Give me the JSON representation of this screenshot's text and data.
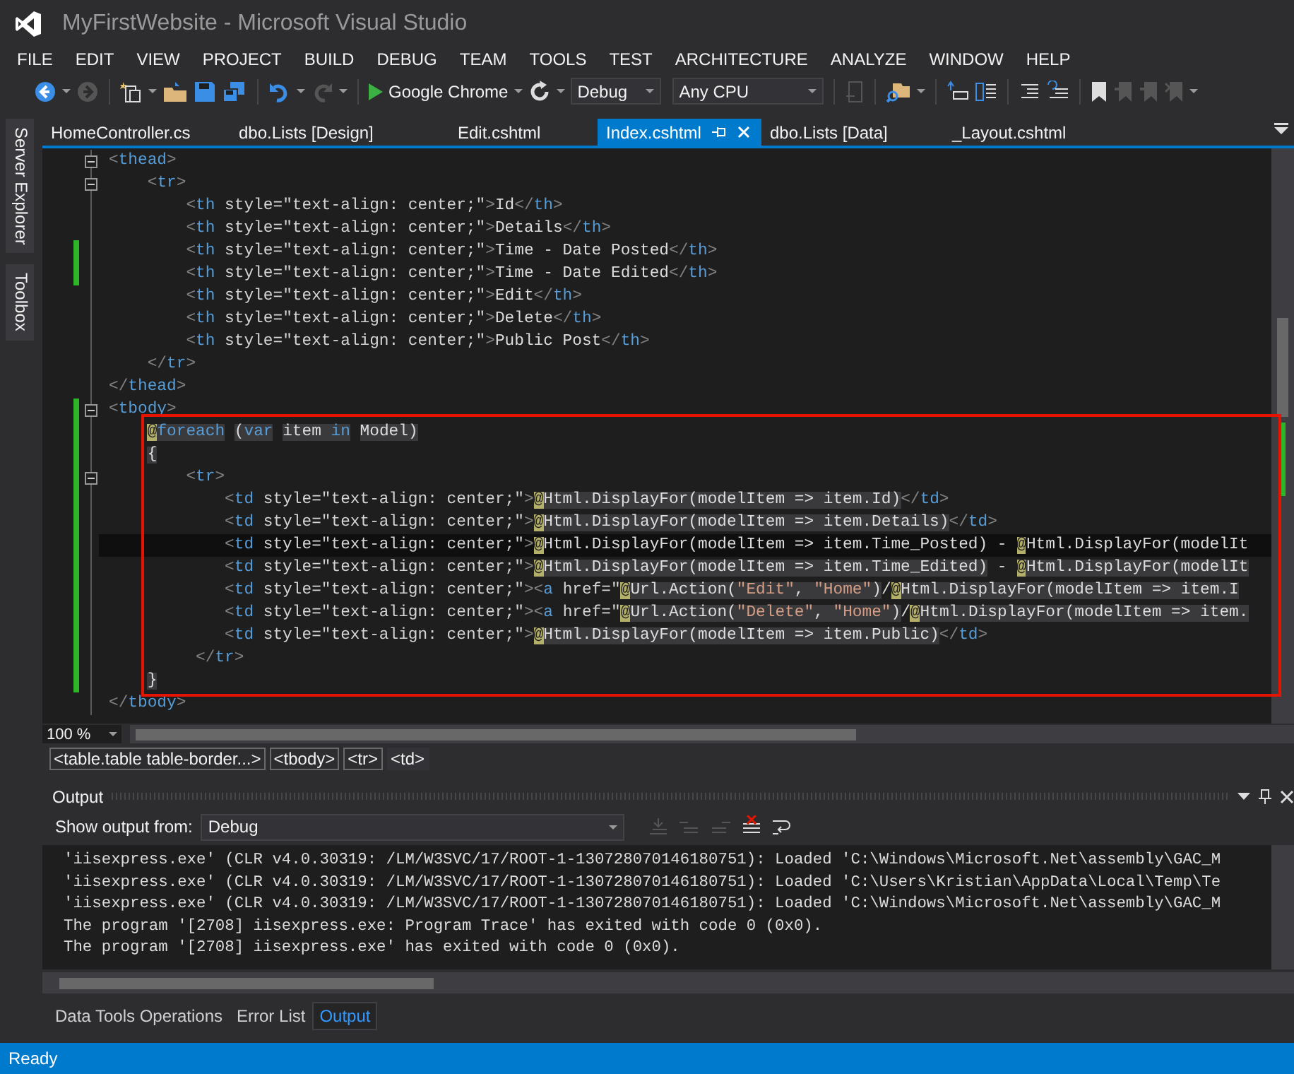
{
  "window": {
    "title": "MyFirstWebsite - Microsoft Visual Studio"
  },
  "menu": [
    "FILE",
    "EDIT",
    "VIEW",
    "PROJECT",
    "BUILD",
    "DEBUG",
    "TEAM",
    "TOOLS",
    "TEST",
    "ARCHITECTURE",
    "ANALYZE",
    "WINDOW",
    "HELP"
  ],
  "toolbar": {
    "run_target": "Google Chrome",
    "configuration": "Debug",
    "platform": "Any CPU"
  },
  "side_tabs": [
    "Server Explorer",
    "Toolbox"
  ],
  "tabs": [
    {
      "label": "HomeController.cs",
      "selected": false
    },
    {
      "label": "dbo.Lists [Design]",
      "selected": false
    },
    {
      "label": "Edit.cshtml",
      "selected": false
    },
    {
      "label": "Index.cshtml",
      "selected": true
    },
    {
      "label": "dbo.Lists [Data]",
      "selected": false
    },
    {
      "label": "_Layout.cshtml",
      "selected": false
    }
  ],
  "editor": {
    "lines": [
      {
        "changed": false,
        "current": false,
        "fold_marker": true,
        "tokens": [
          {
            "text": "<",
            "kind": "p"
          },
          {
            "text": "thead",
            "kind": "tag"
          },
          {
            "text": ">",
            "kind": "p"
          }
        ]
      },
      {
        "changed": false,
        "current": false,
        "fold_marker": true,
        "tokens": [
          {
            "text": "    <",
            "kind": "p"
          },
          {
            "text": "tr",
            "kind": "tag"
          },
          {
            "text": ">",
            "kind": "p"
          }
        ]
      },
      {
        "changed": false,
        "current": false,
        "fold_marker": false,
        "tokens": [
          {
            "text": "        <",
            "kind": "p"
          },
          {
            "text": "th",
            "kind": "tag"
          },
          {
            "text": " style=",
            "kind": "attr"
          },
          {
            "text": "\"text-align: center;\"",
            "kind": "str"
          },
          {
            "text": ">",
            "kind": "p"
          },
          {
            "text": "Id",
            "kind": "txt"
          },
          {
            "text": "</",
            "kind": "p"
          },
          {
            "text": "th",
            "kind": "tag"
          },
          {
            "text": ">",
            "kind": "p"
          }
        ]
      },
      {
        "changed": false,
        "current": false,
        "fold_marker": false,
        "tokens": [
          {
            "text": "        <",
            "kind": "p"
          },
          {
            "text": "th",
            "kind": "tag"
          },
          {
            "text": " style=",
            "kind": "attr"
          },
          {
            "text": "\"text-align: center;\"",
            "kind": "str"
          },
          {
            "text": ">",
            "kind": "p"
          },
          {
            "text": "Details",
            "kind": "txt"
          },
          {
            "text": "</",
            "kind": "p"
          },
          {
            "text": "th",
            "kind": "tag"
          },
          {
            "text": ">",
            "kind": "p"
          }
        ]
      },
      {
        "changed": true,
        "current": false,
        "fold_marker": false,
        "tokens": [
          {
            "text": "        <",
            "kind": "p"
          },
          {
            "text": "th",
            "kind": "tag"
          },
          {
            "text": " style=",
            "kind": "attr"
          },
          {
            "text": "\"text-align: center;\"",
            "kind": "str"
          },
          {
            "text": ">",
            "kind": "p"
          },
          {
            "text": "Time - Date Posted",
            "kind": "txt"
          },
          {
            "text": "</",
            "kind": "p"
          },
          {
            "text": "th",
            "kind": "tag"
          },
          {
            "text": ">",
            "kind": "p"
          }
        ]
      },
      {
        "changed": true,
        "current": false,
        "fold_marker": false,
        "tokens": [
          {
            "text": "        <",
            "kind": "p"
          },
          {
            "text": "th",
            "kind": "tag"
          },
          {
            "text": " style=",
            "kind": "attr"
          },
          {
            "text": "\"text-align: center;\"",
            "kind": "str"
          },
          {
            "text": ">",
            "kind": "p"
          },
          {
            "text": "Time - Date Edited",
            "kind": "txt"
          },
          {
            "text": "</",
            "kind": "p"
          },
          {
            "text": "th",
            "kind": "tag"
          },
          {
            "text": ">",
            "kind": "p"
          }
        ]
      },
      {
        "changed": false,
        "current": false,
        "fold_marker": false,
        "tokens": [
          {
            "text": "        <",
            "kind": "p"
          },
          {
            "text": "th",
            "kind": "tag"
          },
          {
            "text": " style=",
            "kind": "attr"
          },
          {
            "text": "\"text-align: center;\"",
            "kind": "str"
          },
          {
            "text": ">",
            "kind": "p"
          },
          {
            "text": "Edit",
            "kind": "txt"
          },
          {
            "text": "</",
            "kind": "p"
          },
          {
            "text": "th",
            "kind": "tag"
          },
          {
            "text": ">",
            "kind": "p"
          }
        ]
      },
      {
        "changed": false,
        "current": false,
        "fold_marker": false,
        "tokens": [
          {
            "text": "        <",
            "kind": "p"
          },
          {
            "text": "th",
            "kind": "tag"
          },
          {
            "text": " style=",
            "kind": "attr"
          },
          {
            "text": "\"text-align: center;\"",
            "kind": "str"
          },
          {
            "text": ">",
            "kind": "p"
          },
          {
            "text": "Delete",
            "kind": "txt"
          },
          {
            "text": "</",
            "kind": "p"
          },
          {
            "text": "th",
            "kind": "tag"
          },
          {
            "text": ">",
            "kind": "p"
          }
        ]
      },
      {
        "changed": false,
        "current": false,
        "fold_marker": false,
        "tokens": [
          {
            "text": "        <",
            "kind": "p"
          },
          {
            "text": "th",
            "kind": "tag"
          },
          {
            "text": " style=",
            "kind": "attr"
          },
          {
            "text": "\"text-align: center;\"",
            "kind": "str"
          },
          {
            "text": ">",
            "kind": "p"
          },
          {
            "text": "Public Post",
            "kind": "txt"
          },
          {
            "text": "</",
            "kind": "p"
          },
          {
            "text": "th",
            "kind": "tag"
          },
          {
            "text": ">",
            "kind": "p"
          }
        ]
      },
      {
        "changed": false,
        "current": false,
        "fold_marker": false,
        "tokens": [
          {
            "text": "    </",
            "kind": "p"
          },
          {
            "text": "tr",
            "kind": "tag"
          },
          {
            "text": ">",
            "kind": "p"
          }
        ]
      },
      {
        "changed": false,
        "current": false,
        "fold_marker": false,
        "tokens": [
          {
            "text": "</",
            "kind": "p"
          },
          {
            "text": "thead",
            "kind": "tag"
          },
          {
            "text": ">",
            "kind": "p"
          }
        ]
      },
      {
        "changed": true,
        "current": false,
        "fold_marker": true,
        "tokens": [
          {
            "text": "<",
            "kind": "p"
          },
          {
            "text": "tbody",
            "kind": "tag"
          },
          {
            "text": ">",
            "kind": "p"
          }
        ]
      },
      {
        "changed": true,
        "current": false,
        "fold_marker": false,
        "tokens": [
          {
            "text": "    @",
            "kind": "at"
          },
          {
            "text": "foreach",
            "kind": "rkw"
          },
          {
            "text": " (",
            "kind": "razor"
          },
          {
            "text": "var",
            "kind": "rkw"
          },
          {
            "text": " item ",
            "kind": "razor"
          },
          {
            "text": "in",
            "kind": "rkw"
          },
          {
            "text": " Model)",
            "kind": "razor"
          }
        ]
      },
      {
        "changed": true,
        "current": false,
        "fold_marker": false,
        "tokens": [
          {
            "text": "    {",
            "kind": "razor"
          }
        ]
      },
      {
        "changed": true,
        "current": false,
        "fold_marker": true,
        "tokens": [
          {
            "text": "        <",
            "kind": "p"
          },
          {
            "text": "tr",
            "kind": "tag"
          },
          {
            "text": ">",
            "kind": "p"
          }
        ]
      },
      {
        "changed": true,
        "current": false,
        "fold_marker": false,
        "tokens": [
          {
            "text": "            <",
            "kind": "p"
          },
          {
            "text": "td",
            "kind": "tag"
          },
          {
            "text": " style=",
            "kind": "attr"
          },
          {
            "text": "\"text-align: center;\"",
            "kind": "str"
          },
          {
            "text": ">",
            "kind": "p"
          },
          {
            "text": "@",
            "kind": "at"
          },
          {
            "text": "Html.DisplayFor(modelItem => item.Id)",
            "kind": "razor"
          },
          {
            "text": "</",
            "kind": "p"
          },
          {
            "text": "td",
            "kind": "tag"
          },
          {
            "text": ">",
            "kind": "p"
          }
        ]
      },
      {
        "changed": true,
        "current": false,
        "fold_marker": false,
        "tokens": [
          {
            "text": "            <",
            "kind": "p"
          },
          {
            "text": "td",
            "kind": "tag"
          },
          {
            "text": " style=",
            "kind": "attr"
          },
          {
            "text": "\"text-align: center;\"",
            "kind": "str"
          },
          {
            "text": ">",
            "kind": "p"
          },
          {
            "text": "@",
            "kind": "at"
          },
          {
            "text": "Html.DisplayFor(modelItem => item.Details)",
            "kind": "razor"
          },
          {
            "text": "</",
            "kind": "p"
          },
          {
            "text": "td",
            "kind": "tag"
          },
          {
            "text": ">",
            "kind": "p"
          }
        ]
      },
      {
        "changed": true,
        "current": true,
        "fold_marker": false,
        "tokens": [
          {
            "text": "            <",
            "kind": "p"
          },
          {
            "text": "td",
            "kind": "tag"
          },
          {
            "text": " style=",
            "kind": "attr"
          },
          {
            "text": "\"text-align: center;\"",
            "kind": "str"
          },
          {
            "text": ">",
            "kind": "p"
          },
          {
            "text": "@",
            "kind": "at"
          },
          {
            "text": "Html.DisplayFor(modelItem => item.Time_Posted) - ",
            "kind": "txt"
          },
          {
            "text": "@",
            "kind": "at"
          },
          {
            "text": "Html.DisplayFor(modelIt",
            "kind": "txt"
          }
        ]
      },
      {
        "changed": true,
        "current": false,
        "fold_marker": false,
        "tokens": [
          {
            "text": "            <",
            "kind": "p"
          },
          {
            "text": "td",
            "kind": "tag"
          },
          {
            "text": " style=",
            "kind": "attr"
          },
          {
            "text": "\"text-align: center;\"",
            "kind": "str"
          },
          {
            "text": ">",
            "kind": "p"
          },
          {
            "text": "@",
            "kind": "at"
          },
          {
            "text": "Html.DisplayFor(modelItem => item.Time_Edited)",
            "kind": "razor"
          },
          {
            "text": " - ",
            "kind": "txt"
          },
          {
            "text": "@",
            "kind": "at"
          },
          {
            "text": "Html.DisplayFor(modelIt",
            "kind": "razor"
          }
        ]
      },
      {
        "changed": true,
        "current": false,
        "fold_marker": false,
        "tokens": [
          {
            "text": "            <",
            "kind": "p"
          },
          {
            "text": "td",
            "kind": "tag"
          },
          {
            "text": " style=",
            "kind": "attr"
          },
          {
            "text": "\"text-align: center;\"",
            "kind": "str"
          },
          {
            "text": "><",
            "kind": "p"
          },
          {
            "text": "a",
            "kind": "tag"
          },
          {
            "text": " href=",
            "kind": "attr"
          },
          {
            "text": "\"",
            "kind": "str"
          },
          {
            "text": "@",
            "kind": "at"
          },
          {
            "text": "Url.Action(",
            "kind": "razor"
          },
          {
            "text": "\"Edit\"",
            "kind": "rstr"
          },
          {
            "text": ", ",
            "kind": "razor"
          },
          {
            "text": "\"Home\"",
            "kind": "rstr"
          },
          {
            "text": ")",
            "kind": "razor"
          },
          {
            "text": "/",
            "kind": "txt"
          },
          {
            "text": "@",
            "kind": "at"
          },
          {
            "text": "Html.DisplayFor(modelItem => item.I",
            "kind": "razor"
          }
        ]
      },
      {
        "changed": true,
        "current": false,
        "fold_marker": false,
        "tokens": [
          {
            "text": "            <",
            "kind": "p"
          },
          {
            "text": "td",
            "kind": "tag"
          },
          {
            "text": " style=",
            "kind": "attr"
          },
          {
            "text": "\"text-align: center;\"",
            "kind": "str"
          },
          {
            "text": "><",
            "kind": "p"
          },
          {
            "text": "a",
            "kind": "tag"
          },
          {
            "text": " href=",
            "kind": "attr"
          },
          {
            "text": "\"",
            "kind": "str"
          },
          {
            "text": "@",
            "kind": "at"
          },
          {
            "text": "Url.Action(",
            "kind": "razor"
          },
          {
            "text": "\"Delete\"",
            "kind": "rstr"
          },
          {
            "text": ", ",
            "kind": "razor"
          },
          {
            "text": "\"Home\"",
            "kind": "rstr"
          },
          {
            "text": ")",
            "kind": "razor"
          },
          {
            "text": "/",
            "kind": "txt"
          },
          {
            "text": "@",
            "kind": "at"
          },
          {
            "text": "Html.DisplayFor(modelItem => item.",
            "kind": "razor"
          }
        ]
      },
      {
        "changed": true,
        "current": false,
        "fold_marker": false,
        "tokens": [
          {
            "text": "            <",
            "kind": "p"
          },
          {
            "text": "td",
            "kind": "tag"
          },
          {
            "text": " style=",
            "kind": "attr"
          },
          {
            "text": "\"text-align: center;\"",
            "kind": "str"
          },
          {
            "text": ">",
            "kind": "p"
          },
          {
            "text": "@",
            "kind": "at"
          },
          {
            "text": "Html.DisplayFor(modelItem => item.Public)",
            "kind": "razor"
          },
          {
            "text": "</",
            "kind": "p"
          },
          {
            "text": "td",
            "kind": "tag"
          },
          {
            "text": ">",
            "kind": "p"
          }
        ]
      },
      {
        "changed": true,
        "current": false,
        "fold_marker": false,
        "tokens": [
          {
            "text": "         </",
            "kind": "p"
          },
          {
            "text": "tr",
            "kind": "tag"
          },
          {
            "text": ">",
            "kind": "p"
          }
        ]
      },
      {
        "changed": true,
        "current": false,
        "fold_marker": false,
        "tokens": [
          {
            "text": "    }",
            "kind": "razor"
          }
        ]
      },
      {
        "changed": false,
        "current": false,
        "fold_marker": false,
        "tokens": [
          {
            "text": "</",
            "kind": "p"
          },
          {
            "text": "tbody",
            "kind": "tag"
          },
          {
            "text": ">",
            "kind": "p"
          }
        ]
      }
    ]
  },
  "zoom": "100 %",
  "breadcrumbs": [
    {
      "label": "<table.table table-border...>",
      "selected": false
    },
    {
      "label": "<tbody>",
      "selected": false
    },
    {
      "label": "<tr>",
      "selected": false
    },
    {
      "label": "<td>",
      "selected": true
    }
  ],
  "output": {
    "title": "Output",
    "source_label": "Show output from:",
    "source": "Debug",
    "lines": [
      "'iisexpress.exe' (CLR v4.0.30319: /LM/W3SVC/17/ROOT-1-130728070146180751): Loaded 'C:\\Windows\\Microsoft.Net\\assembly\\GAC_M",
      "'iisexpress.exe' (CLR v4.0.30319: /LM/W3SVC/17/ROOT-1-130728070146180751): Loaded 'C:\\Users\\Kristian\\AppData\\Local\\Temp\\Te",
      "'iisexpress.exe' (CLR v4.0.30319: /LM/W3SVC/17/ROOT-1-130728070146180751): Loaded 'C:\\Windows\\Microsoft.Net\\assembly\\GAC_M",
      "The program '[2708] iisexpress.exe: Program Trace' has exited with code 0 (0x0).",
      "The program '[2708] iisexpress.exe' has exited with code 0 (0x0)."
    ]
  },
  "bottom_tabs": [
    {
      "label": "Data Tools Operations",
      "selected": false
    },
    {
      "label": "Error List",
      "selected": false
    },
    {
      "label": "Output",
      "selected": true
    }
  ],
  "status_bar": {
    "text": "Ready"
  }
}
